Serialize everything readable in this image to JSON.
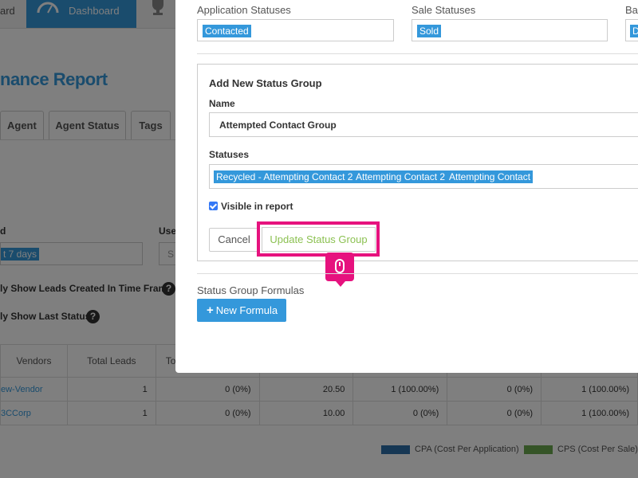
{
  "background": {
    "nav": {
      "prev_item_label": "ard",
      "dashboard_label": "Dashboard",
      "icons": [
        "dashboard-icon",
        "trophy-icon"
      ]
    },
    "report_title": "nance Report",
    "tabs": [
      "Agent",
      "Agent Status",
      "Tags"
    ],
    "filters": {
      "date_label": "d",
      "date_value": "t 7 days",
      "user_label": "Use",
      "user_value": "S",
      "option_1": "ly Show Leads Created In Time Frame",
      "option_2": "ly Show Last Status",
      "help_icon": "?"
    },
    "table": {
      "headers": [
        "Vendors",
        "Total Leads",
        "To",
        "",
        "",
        "",
        ""
      ],
      "rows": [
        [
          "ew-Vendor",
          "1",
          "0 (0%)",
          "20.50",
          "1 (100.00%)",
          "0 (0%)",
          "1 (100.00%)"
        ],
        [
          "3CCorp",
          "1",
          "0 (0%)",
          "10.00",
          "0 (0%)",
          "0 (0%)",
          "1 (100.00%)"
        ]
      ]
    },
    "legend": [
      {
        "label": "CPA (Cost Per Application)",
        "color": "#2d6fa8"
      },
      {
        "label": "CPS (Cost Per Sale)",
        "color": "#6aa84f"
      }
    ]
  },
  "modal": {
    "application_statuses": {
      "label": "Application Statuses",
      "chip": "Contacted"
    },
    "sale_statuses": {
      "label": "Sale Statuses",
      "chip": "Sold"
    },
    "third_statuses": {
      "label": "Ba",
      "chip": "D"
    },
    "group": {
      "title": "Add New Status Group",
      "name_label": "Name",
      "name_value": "Attempted Contact Group",
      "statuses_label": "Statuses",
      "status_chips": [
        "Recycled - Attempting Contact 2",
        "Attempting Contact 2",
        "Attempting Contact"
      ],
      "visible_label": "Visible in report",
      "visible_checked": true,
      "cancel_label": "Cancel",
      "update_label": "Update Status Group"
    },
    "formulas_label": "Status Group Formulas",
    "new_formula_label": "New Formula",
    "new_formula_icon": "plus-icon"
  },
  "colors": {
    "accent": "#3498db",
    "highlight": "#e6127e",
    "success_text": "#8cc152"
  }
}
